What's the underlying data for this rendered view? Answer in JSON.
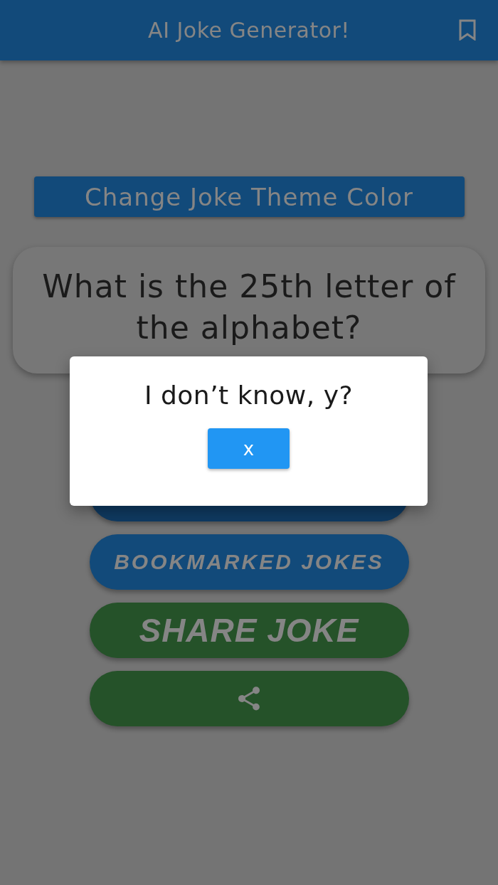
{
  "app_bar": {
    "title": "AI Joke Generator!"
  },
  "theme_button": {
    "label": "Change Joke Theme Color"
  },
  "joke": {
    "text": "What is the 25th letter of the alphabet?"
  },
  "buttons": [
    {
      "kind": "covered",
      "color": "#0f3a61"
    },
    {
      "kind": "label",
      "label": "BOOKMARKED JOKES",
      "color": "#124a7a"
    },
    {
      "kind": "headline",
      "label": "SHARE JOKE",
      "color": "#255229"
    },
    {
      "kind": "icon",
      "color": "#255229"
    }
  ],
  "dialog": {
    "text": "I don’t know, y?",
    "button": "x"
  }
}
